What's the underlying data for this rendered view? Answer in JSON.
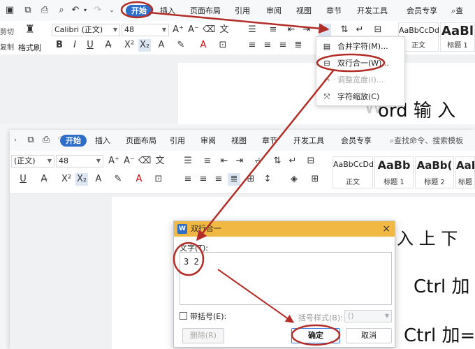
{
  "top_window": {
    "tabs": [
      {
        "label": "开始",
        "active": true
      },
      {
        "label": "插入"
      },
      {
        "label": "页面布局"
      },
      {
        "label": "引用"
      },
      {
        "label": "审阅"
      },
      {
        "label": "视图"
      },
      {
        "label": "章节"
      },
      {
        "label": "开发工具"
      },
      {
        "label": "会员专享"
      },
      {
        "label": "查"
      }
    ],
    "side_labels": {
      "cut": "剪切",
      "copy": "复制",
      "format_painter": "格式刷"
    },
    "font_name": "Calibri (正文)",
    "font_size": "48",
    "styles": [
      {
        "sample": "AaBbCcDd",
        "name": "正文"
      },
      {
        "sample": "AaBl",
        "name": "标题 1"
      }
    ],
    "doc_text": "ord 输 入",
    "doc_text_partial": "W"
  },
  "menu": {
    "items": [
      {
        "label": "合并字符(M)...",
        "icon": "merge-chars-icon"
      },
      {
        "label": "双行合一(W)...",
        "icon": "two-lines-icon"
      },
      {
        "label": "调整宽度(I)...",
        "icon": "adjust-width-icon",
        "disabled": true
      },
      {
        "label": "字符缩放(C)",
        "icon": "char-scale-icon"
      }
    ]
  },
  "second_window": {
    "tabs": [
      {
        "label": "开始",
        "active": true
      },
      {
        "label": "插入"
      },
      {
        "label": "页面布局"
      },
      {
        "label": "引用"
      },
      {
        "label": "审阅"
      },
      {
        "label": "视图"
      },
      {
        "label": "章节"
      },
      {
        "label": "开发工具"
      },
      {
        "label": "会员专享"
      }
    ],
    "search_placeholder": "查找命令、搜索模板",
    "font_name": "(正文)",
    "font_size": "48",
    "styles": [
      {
        "sample": "AaBbCcDd",
        "name": "正文"
      },
      {
        "sample": "AaBb",
        "name": "标题 1"
      },
      {
        "sample": "AaBb(",
        "name": "标题 2"
      },
      {
        "sample": "AaB",
        "name": "标题"
      }
    ],
    "doc_lines": [
      {
        "text": "入 上 下"
      },
      {
        "text": "Ctrl 加"
      },
      {
        "text": "Ctrl 加="
      }
    ]
  },
  "dialog": {
    "title": "双行合一",
    "logo": "W",
    "close": "×",
    "text_label": "文字(T):",
    "text_value": "3 2",
    "bracket_label": "带括号(E):",
    "bracket_style_label": "括号样式(B):",
    "bracket_style_value": "()",
    "delete_label": "删除(R)",
    "ok_label": "确定",
    "cancel_label": "取消"
  },
  "colors": {
    "accent": "#2f6ec8",
    "dialog_title": "#f1b843",
    "annotation": "#b32d28"
  }
}
